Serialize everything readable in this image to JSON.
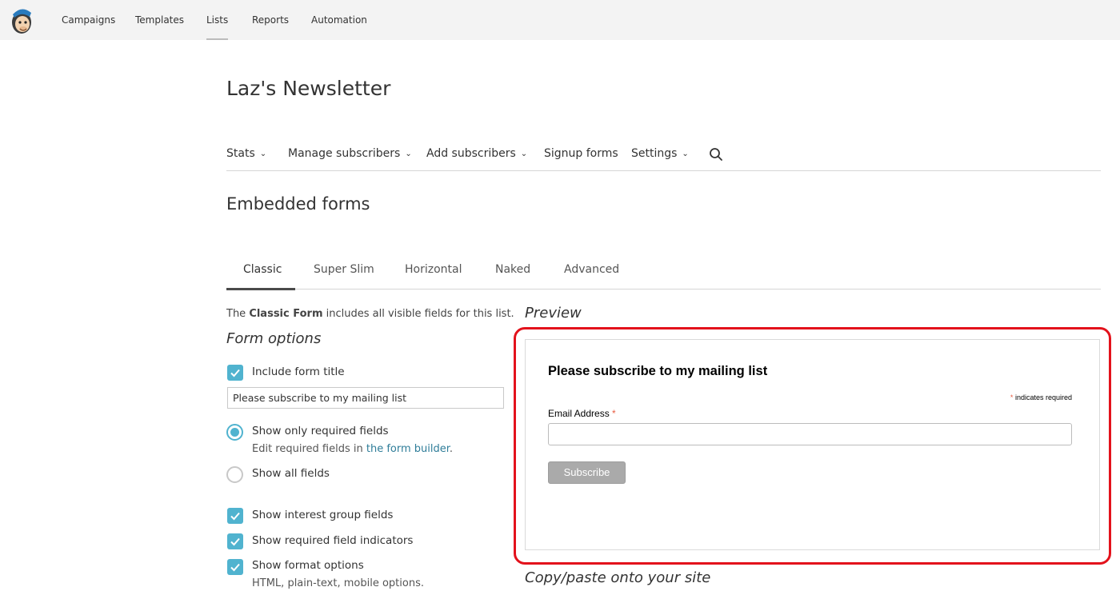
{
  "topnav": {
    "items": [
      "Campaigns",
      "Templates",
      "Lists",
      "Reports",
      "Automation"
    ],
    "active": "Lists"
  },
  "list_title": "Laz's Newsletter",
  "subnav": {
    "stats": "Stats",
    "manage": "Manage subscribers",
    "add": "Add subscribers",
    "signup": "Signup forms",
    "settings": "Settings"
  },
  "section_title": "Embedded forms",
  "tabs": [
    "Classic",
    "Super Slim",
    "Horizontal",
    "Naked",
    "Advanced"
  ],
  "intro": {
    "prefix": "The ",
    "bold": "Classic Form",
    "suffix": " includes all visible fields for this list."
  },
  "form_options": {
    "heading": "Form options",
    "include_title_label": "Include form title",
    "include_title_checked": true,
    "title_value": "Please subscribe to my mailing list",
    "show_required_label": "Show only required fields",
    "show_required_selected": true,
    "show_required_help_prefix": "Edit required fields in ",
    "show_required_help_link": "the form builder",
    "show_required_help_suffix": ".",
    "show_all_label": "Show all fields",
    "show_all_selected": false,
    "interest_label": "Show interest group fields",
    "indicators_label": "Show required field indicators",
    "format_label": "Show format options",
    "format_help": "HTML, plain-text, mobile options."
  },
  "preview": {
    "heading": "Preview",
    "form_title": "Please subscribe to my mailing list",
    "required_note": "indicates required",
    "asterisk": "*",
    "email_label": "Email Address",
    "subscribe_button": "Subscribe"
  },
  "copy_heading": "Copy/paste onto your site",
  "colors": {
    "accent": "#50b3cf",
    "highlight": "#e3121c",
    "link": "#2f7d99",
    "button": "#aaaaaa"
  }
}
